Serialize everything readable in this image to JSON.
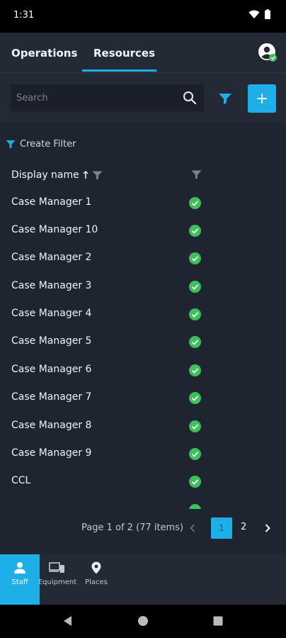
{
  "status_bar": {
    "time": "1:31"
  },
  "tabs": [
    {
      "label": "Operations",
      "active": false
    },
    {
      "label": "Resources",
      "active": true
    }
  ],
  "search": {
    "placeholder": "Search",
    "value": ""
  },
  "create_filter_label": "Create Filter",
  "columns": {
    "display_name": "Display name"
  },
  "rows": [
    {
      "name": "Case Manager 1",
      "status": "check"
    },
    {
      "name": "Case Manager 10",
      "status": "check"
    },
    {
      "name": "Case Manager 2",
      "status": "check"
    },
    {
      "name": "Case Manager 3",
      "status": "check"
    },
    {
      "name": "Case Manager 4",
      "status": "check"
    },
    {
      "name": "Case Manager 5",
      "status": "check"
    },
    {
      "name": "Case Manager 6",
      "status": "check"
    },
    {
      "name": "Case Manager 7",
      "status": "check"
    },
    {
      "name": "Case Manager 8",
      "status": "check"
    },
    {
      "name": "Case Manager 9",
      "status": "check"
    },
    {
      "name": "CCL",
      "status": "check"
    }
  ],
  "pager": {
    "info": "Page 1 of 2 (77 items)",
    "pages": [
      "1",
      "2"
    ],
    "current": "1"
  },
  "bottom_nav": [
    {
      "label": "Staff",
      "icon": "person-icon",
      "active": true
    },
    {
      "label": "Equipment",
      "icon": "devices-icon",
      "active": false
    },
    {
      "label": "Places",
      "icon": "location-pin-icon",
      "active": false
    }
  ],
  "colors": {
    "accent": "#1eaee8",
    "background": "#1e2430",
    "check_green": "#3fbf5a"
  }
}
